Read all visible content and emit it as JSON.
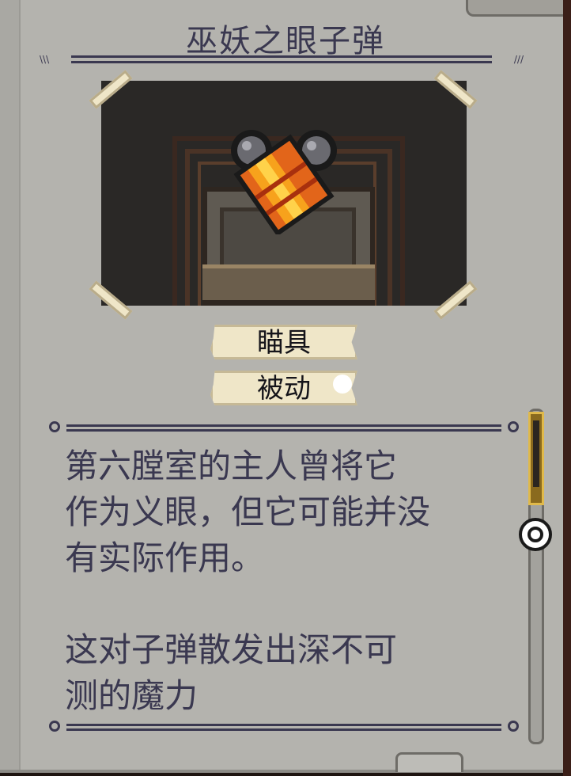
{
  "item": {
    "title": "巫妖之眼子弹",
    "quality_label": "瞄具",
    "type_label": "被动",
    "image_icon": "lich-eye-bullets-icon"
  },
  "description": {
    "paragraphs": [
      "第六膛室的主人曾将它",
      "作为义眼，但它可能并没",
      "有实际作用。",
      "",
      "这对子弹散发出深不可",
      "测的魔力"
    ]
  },
  "colors": {
    "page": "#b4b3ae",
    "ink": "#3a3850",
    "tag": "#efe6c8",
    "scroll_gold": "#e0b94a"
  },
  "scroll": {
    "position_fraction": 0.0
  }
}
